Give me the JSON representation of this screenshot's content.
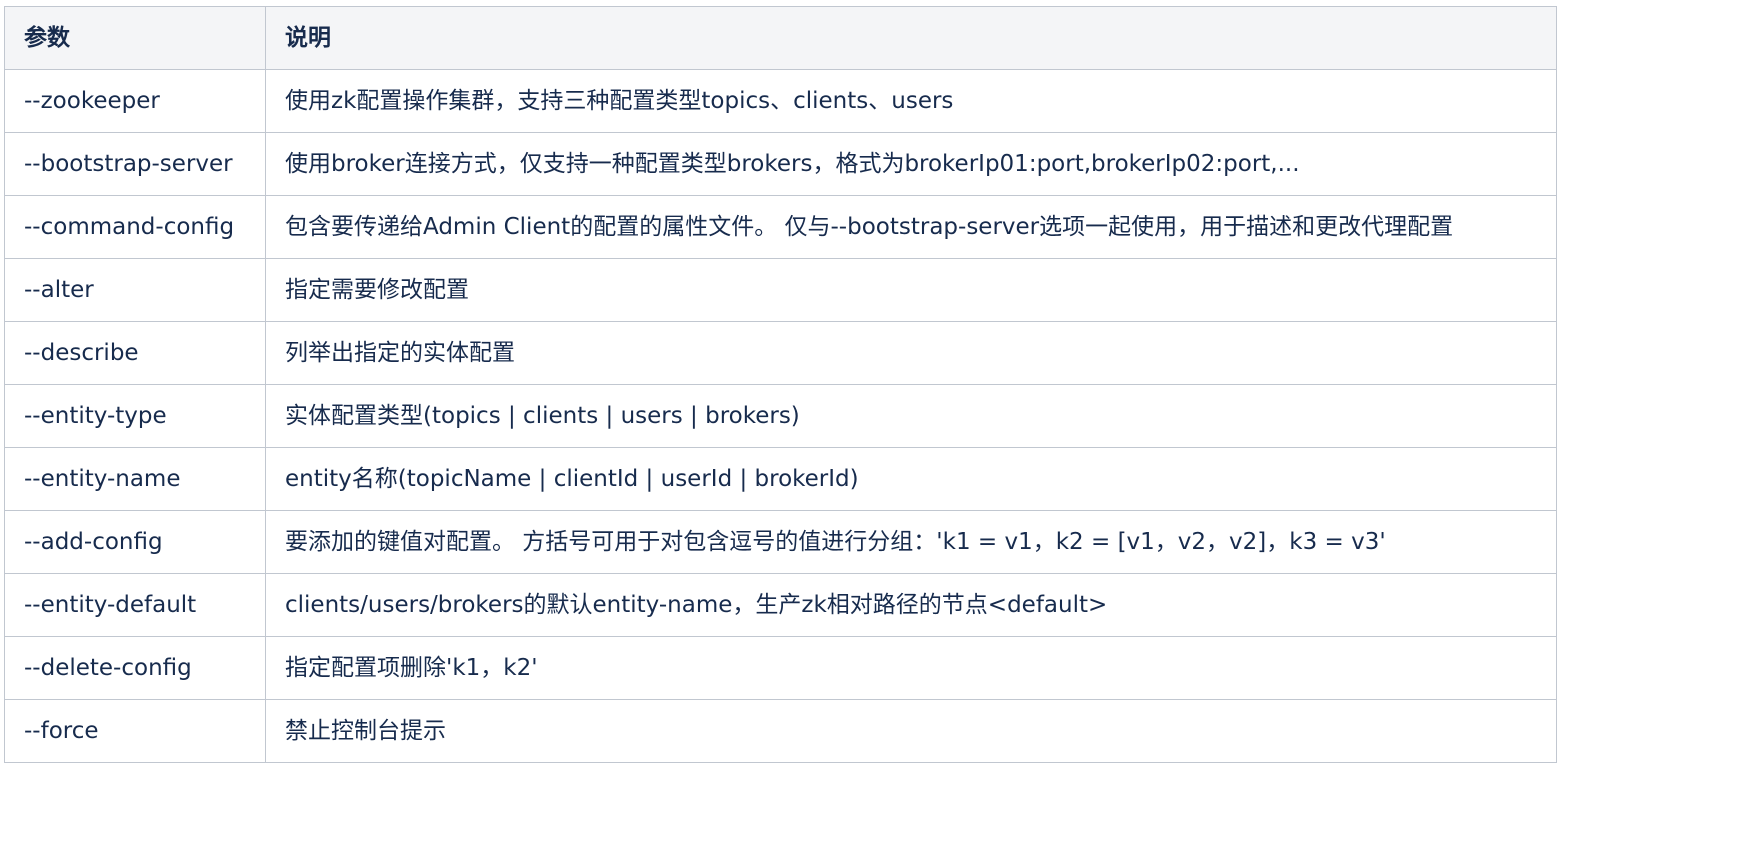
{
  "table": {
    "headers": [
      "参数",
      "说明"
    ],
    "rows": [
      [
        "--zookeeper",
        "使用zk配置操作集群，支持三种配置类型topics、clients、users"
      ],
      [
        "--bootstrap-server",
        "使用broker连接方式，仅支持一种配置类型brokers，格式为brokerIp01:port,brokerIp02:port,..."
      ],
      [
        "--command-config",
        "包含要传递给Admin Client的配置的属性文件。 仅与--bootstrap-server选项一起使用，用于描述和更改代理配置"
      ],
      [
        "--alter",
        "指定需要修改配置"
      ],
      [
        "--describe",
        "列举出指定的实体配置"
      ],
      [
        "--entity-type",
        "实体配置类型(topics | clients | users | brokers)"
      ],
      [
        "--entity-name",
        "entity名称(topicName | clientId | userId | brokerId)"
      ],
      [
        "--add-config",
        "要添加的键值对配置。 方括号可用于对包含逗号的值进行分组：'k1 = v1，k2 = [v1，v2，v2]，k3 = v3'"
      ],
      [
        "--entity-default",
        "clients/users/brokers的默认entity-name，生产zk相对路径的节点<default>"
      ],
      [
        "--delete-config",
        "指定配置项删除'k1，k2'"
      ],
      [
        "--force",
        "禁止控制台提示"
      ]
    ]
  }
}
